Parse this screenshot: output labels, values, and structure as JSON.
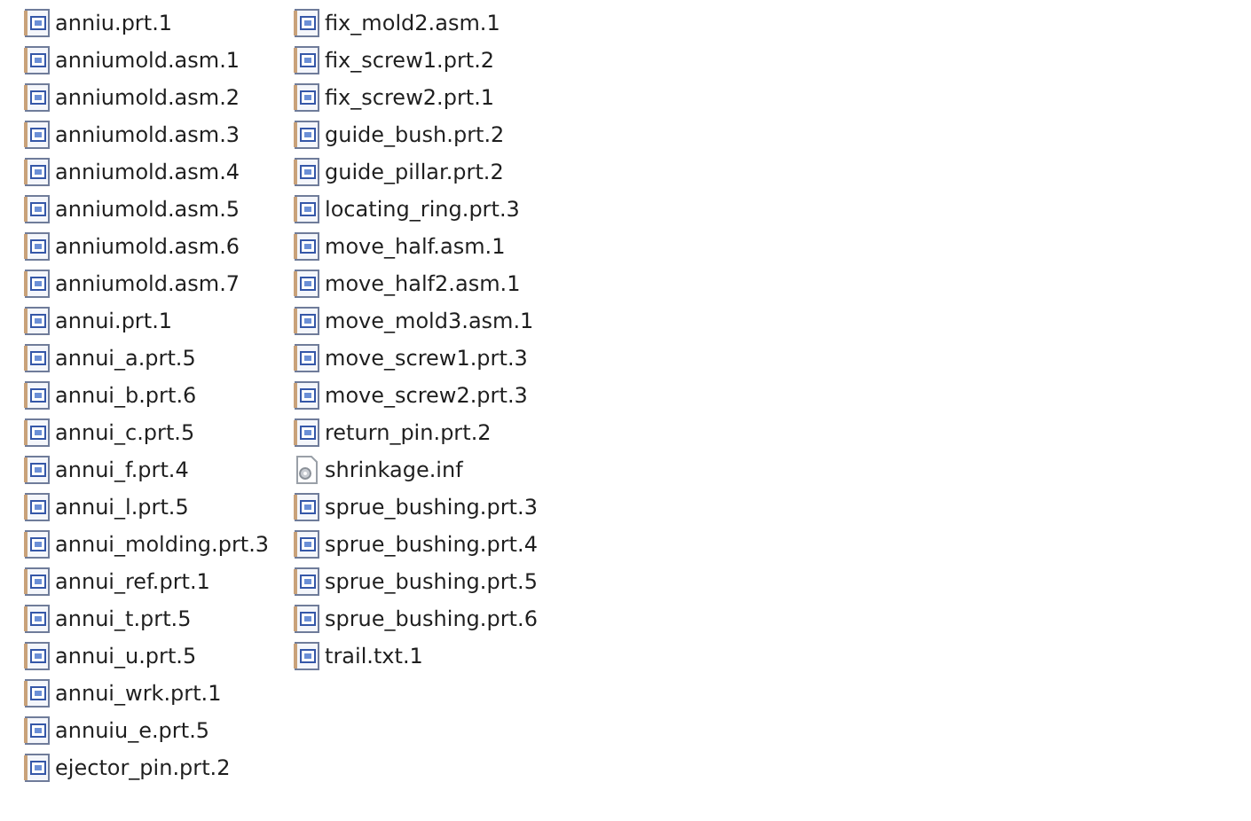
{
  "files": [
    {
      "name": "anniu.prt.1",
      "kind": "model"
    },
    {
      "name": "anniumold.asm.1",
      "kind": "model"
    },
    {
      "name": "anniumold.asm.2",
      "kind": "model"
    },
    {
      "name": "anniumold.asm.3",
      "kind": "model"
    },
    {
      "name": "anniumold.asm.4",
      "kind": "model"
    },
    {
      "name": "anniumold.asm.5",
      "kind": "model"
    },
    {
      "name": "anniumold.asm.6",
      "kind": "model"
    },
    {
      "name": "anniumold.asm.7",
      "kind": "model"
    },
    {
      "name": "annui.prt.1",
      "kind": "model"
    },
    {
      "name": "annui_a.prt.5",
      "kind": "model"
    },
    {
      "name": "annui_b.prt.6",
      "kind": "model"
    },
    {
      "name": "annui_c.prt.5",
      "kind": "model"
    },
    {
      "name": "annui_f.prt.4",
      "kind": "model"
    },
    {
      "name": "annui_l.prt.5",
      "kind": "model"
    },
    {
      "name": "annui_molding.prt.3",
      "kind": "model"
    },
    {
      "name": "annui_ref.prt.1",
      "kind": "model"
    },
    {
      "name": "annui_t.prt.5",
      "kind": "model"
    },
    {
      "name": "annui_u.prt.5",
      "kind": "model"
    },
    {
      "name": "annui_wrk.prt.1",
      "kind": "model"
    },
    {
      "name": "annuiu_e.prt.5",
      "kind": "model"
    },
    {
      "name": "ejector_pin.prt.2",
      "kind": "model"
    },
    {
      "name": "fix_mold2.asm.1",
      "kind": "model"
    },
    {
      "name": "fix_screw1.prt.2",
      "kind": "model"
    },
    {
      "name": "fix_screw2.prt.1",
      "kind": "model"
    },
    {
      "name": "guide_bush.prt.2",
      "kind": "model"
    },
    {
      "name": "guide_pillar.prt.2",
      "kind": "model"
    },
    {
      "name": "locating_ring.prt.3",
      "kind": "model"
    },
    {
      "name": "move_half.asm.1",
      "kind": "model"
    },
    {
      "name": "move_half2.asm.1",
      "kind": "model"
    },
    {
      "name": "move_mold3.asm.1",
      "kind": "model"
    },
    {
      "name": "move_screw1.prt.3",
      "kind": "model"
    },
    {
      "name": "move_screw2.prt.3",
      "kind": "model"
    },
    {
      "name": "return_pin.prt.2",
      "kind": "model"
    },
    {
      "name": "shrinkage.inf",
      "kind": "settings"
    },
    {
      "name": "sprue_bushing.prt.3",
      "kind": "model"
    },
    {
      "name": "sprue_bushing.prt.4",
      "kind": "model"
    },
    {
      "name": "sprue_bushing.prt.5",
      "kind": "model"
    },
    {
      "name": "sprue_bushing.prt.6",
      "kind": "model"
    },
    {
      "name": "trail.txt.1",
      "kind": "model"
    }
  ]
}
